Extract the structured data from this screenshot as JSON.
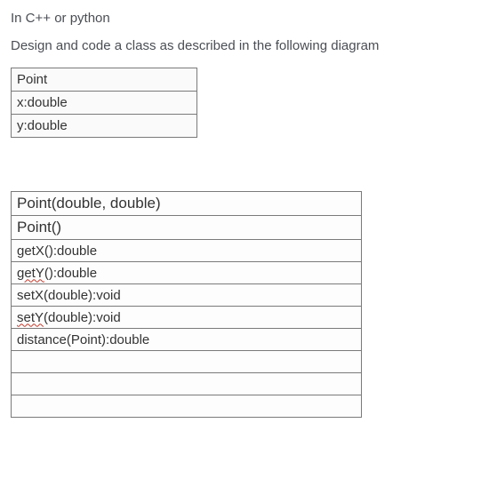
{
  "header": {
    "line1": "In C++ or python",
    "line2_prefix": "Design and code a ",
    "line2_bold": "class",
    "line2_suffix": " as described in the following diagram"
  },
  "uml": {
    "className": "Point",
    "attributes": [
      "x:double",
      "y:double"
    ],
    "methods": [
      {
        "text": "Point(double, double)",
        "wavy": false
      },
      {
        "text": "Point()",
        "wavy": false
      },
      {
        "text": "getX():double",
        "wavy": false
      },
      {
        "prefix": "getY",
        "suffix": "():double",
        "wavy": true
      },
      {
        "text": "setX(double):void",
        "wavy": false
      },
      {
        "prefix": "setY",
        "suffix": "(double):void",
        "wavy": true
      },
      {
        "text": "distance(Point):double",
        "wavy": false
      },
      {
        "text": "",
        "wavy": false
      },
      {
        "text": "",
        "wavy": false
      },
      {
        "text": "",
        "wavy": false
      }
    ]
  }
}
